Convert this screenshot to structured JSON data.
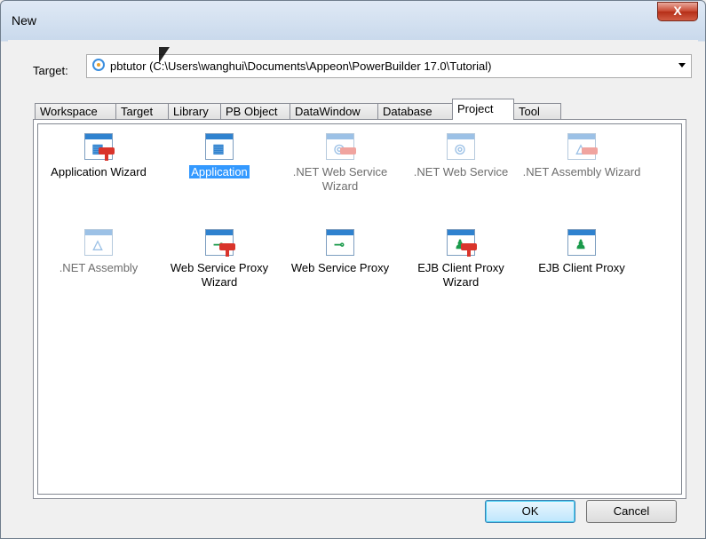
{
  "window": {
    "title": "New",
    "close_label": "X"
  },
  "target": {
    "label": "Target:",
    "value": "pbtutor (C:\\Users\\wanghui\\Documents\\Appeon\\PowerBuilder 17.0\\Tutorial)"
  },
  "tabs": [
    {
      "label": "Workspace"
    },
    {
      "label": "Target"
    },
    {
      "label": "Library"
    },
    {
      "label": "PB Object"
    },
    {
      "label": "DataWindow"
    },
    {
      "label": "Database"
    },
    {
      "label": "Project",
      "active": true
    },
    {
      "label": "Tool"
    }
  ],
  "items": [
    {
      "label": "Application Wizard",
      "icon": "application-wizard-icon"
    },
    {
      "label": "Application",
      "icon": "application-icon",
      "selected": true
    },
    {
      "label": ".NET Web Service Wizard",
      "icon": "net-web-service-wizard-icon",
      "disabled": true
    },
    {
      "label": ".NET Web Service",
      "icon": "net-web-service-icon",
      "disabled": true
    },
    {
      "label": ".NET Assembly Wizard",
      "icon": "net-assembly-wizard-icon",
      "disabled": true
    },
    {
      "label": ".NET Assembly",
      "icon": "net-assembly-icon",
      "disabled": true
    },
    {
      "label": "Web Service Proxy Wizard",
      "icon": "web-service-proxy-wizard-icon"
    },
    {
      "label": "Web Service Proxy",
      "icon": "web-service-proxy-icon"
    },
    {
      "label": "EJB Client Proxy Wizard",
      "icon": "ejb-client-proxy-wizard-icon"
    },
    {
      "label": "EJB Client Proxy",
      "icon": "ejb-client-proxy-icon"
    }
  ],
  "buttons": {
    "ok": "OK",
    "cancel": "Cancel"
  },
  "colors": {
    "selection": "#3399ff",
    "accent": "#2f82cf",
    "wizard_red": "#d9342b"
  }
}
